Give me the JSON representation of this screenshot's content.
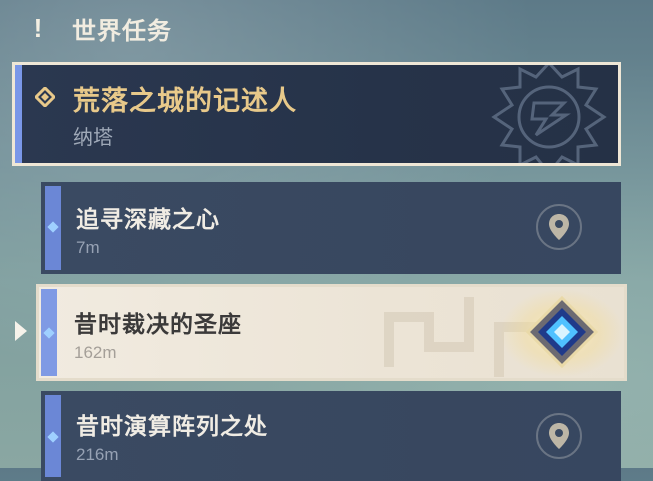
{
  "header": {
    "icon": "exclamation-icon",
    "title": "世界任务"
  },
  "quest": {
    "icon": "quest-diamond-icon",
    "title": "荒落之城的记述人",
    "region": "纳塔",
    "emblem": "natlan-emblem-icon",
    "accent_color": "#7a97e8",
    "title_color": "#e8c98a"
  },
  "objectives": [
    {
      "title": "追寻深藏之心",
      "distance": "7m",
      "selected": false,
      "icon": "map-pin-icon"
    },
    {
      "title": "昔时裁决的圣座",
      "distance": "162m",
      "selected": true,
      "icon": "tracking-diamond-icon"
    },
    {
      "title": "昔时演算阵列之处",
      "distance": "216m",
      "selected": false,
      "icon": "map-pin-icon"
    }
  ]
}
